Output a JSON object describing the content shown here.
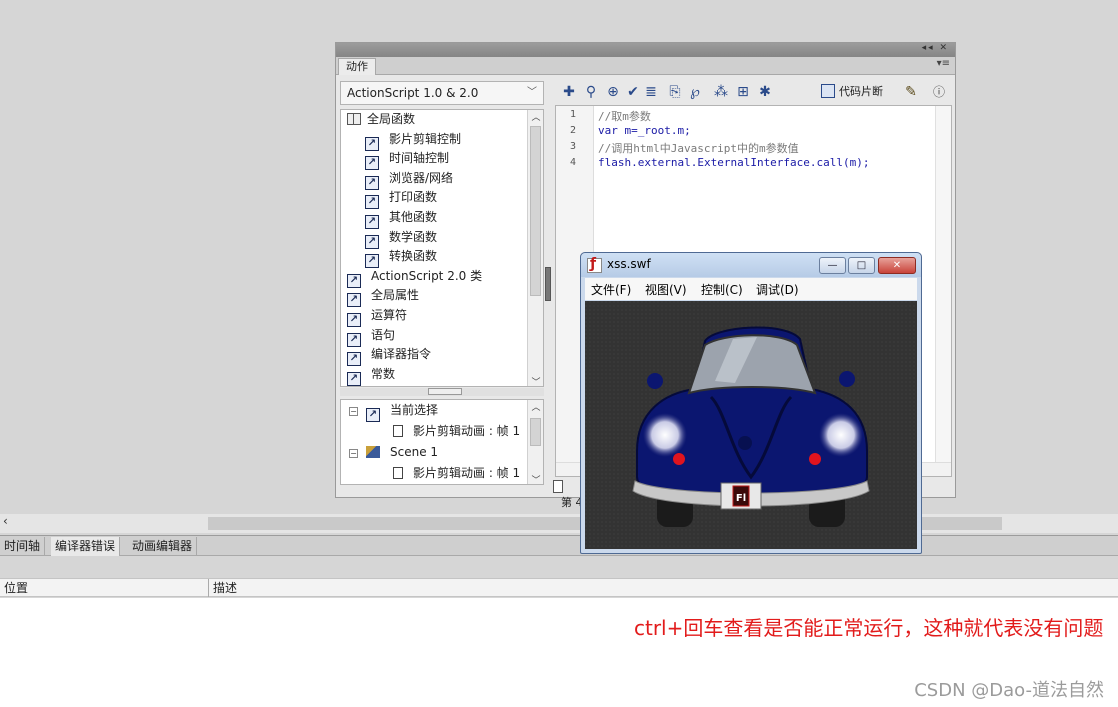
{
  "actions_panel": {
    "tab_label": "动作",
    "panel_controls": "◂◂  ✕",
    "panel_menu": "▾≡",
    "version_select": "ActionScript 1.0 & 2.0",
    "tree": {
      "root": "全局函数",
      "children": [
        "影片剪辑控制",
        "时间轴控制",
        "浏览器/网络",
        "打印函数",
        "其他函数",
        "数学函数",
        "转换函数"
      ],
      "siblings": [
        "ActionScript 2.0 类",
        "全局属性",
        "运算符",
        "语句",
        "编译器指令",
        "常数"
      ]
    },
    "tree2": {
      "items": [
        {
          "label": "当前选择"
        },
        {
          "label": "影片剪辑动画 : 帧 1"
        },
        {
          "label": "Scene 1"
        },
        {
          "label": "影片剪辑动画 : 帧 1"
        }
      ]
    },
    "toolbar": {
      "icons": [
        "add-statement-icon",
        "find-icon",
        "target-icon",
        "check-syntax-icon",
        "auto-format-icon",
        "code-hint-icon",
        "debug-options-icon",
        "collapse-icon",
        "collapse-selection-icon",
        "expand-all-icon",
        "code-snippets-icon",
        "magic-wand-icon",
        "help-icon"
      ],
      "snippet_label": "代码片断"
    },
    "editor": {
      "line_numbers": [
        "1",
        "2",
        "3",
        "4"
      ],
      "lines": [
        "//取m参数",
        "var m=_root.m;",
        "//调用html中Javascript中的m参数值",
        "flash.external.ExternalInterface.call(m);"
      ]
    },
    "status": "第 4"
  },
  "bottom_panel": {
    "tabs": [
      "时间轴",
      "编译器错误",
      "动画编辑器"
    ],
    "active_tab": "编译器错误",
    "columns": [
      "位置",
      "描述"
    ]
  },
  "swf_window": {
    "title": "xss.swf",
    "menus": [
      "文件(F)",
      "视图(V)",
      "控制(C)",
      "调试(D)"
    ],
    "controls": {
      "minimize": "—",
      "maximize": "□",
      "close": "✕"
    },
    "plate_text": "Fl"
  },
  "annotation": "ctrl+回车查看是否能正常运行，这种就代表没有问题",
  "watermark": "CSDN @Dao-道法自然",
  "colors": {
    "annotation": "#e21b1b",
    "car_body": "#0b1670",
    "stage_bg": "#3a3a3a",
    "code_blue": "#1a1aa6"
  }
}
